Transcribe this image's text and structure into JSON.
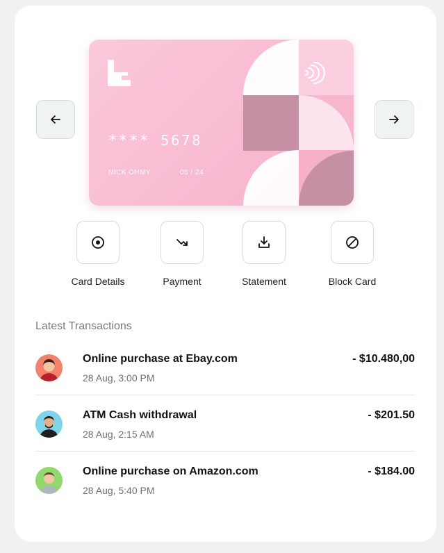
{
  "card": {
    "number": "**** 5678",
    "holder": "NICK OHMY",
    "expiry": "05 / 24",
    "colors": {
      "base": "#f8bcd2",
      "dark": "#c98fa6",
      "light": "#fde3ed"
    }
  },
  "nav": {
    "prev_icon": "arrow-left-icon",
    "next_icon": "arrow-right-icon"
  },
  "actions": [
    {
      "label": "Card Details",
      "icon": "target-circle-icon"
    },
    {
      "label": "Payment",
      "icon": "arrow-down-right-icon"
    },
    {
      "label": "Statement",
      "icon": "download-icon"
    },
    {
      "label": "Block Card",
      "icon": "block-icon"
    }
  ],
  "transactions": {
    "title": "Latest Transactions",
    "items": [
      {
        "title": "Online purchase at Ebay.com",
        "time": "28 Aug, 3:00 PM",
        "amount": "- $10.480,00",
        "avatar_bg": "#f2826c"
      },
      {
        "title": "ATM Cash withdrawal",
        "time": "28 Aug, 2:15 AM",
        "amount": "- $201.50",
        "avatar_bg": "#7fd3ea"
      },
      {
        "title": "Online purchase on Amazon.com",
        "time": "28 Aug, 5:40 PM",
        "amount": "- $184.00",
        "avatar_bg": "#92d86c"
      }
    ]
  }
}
